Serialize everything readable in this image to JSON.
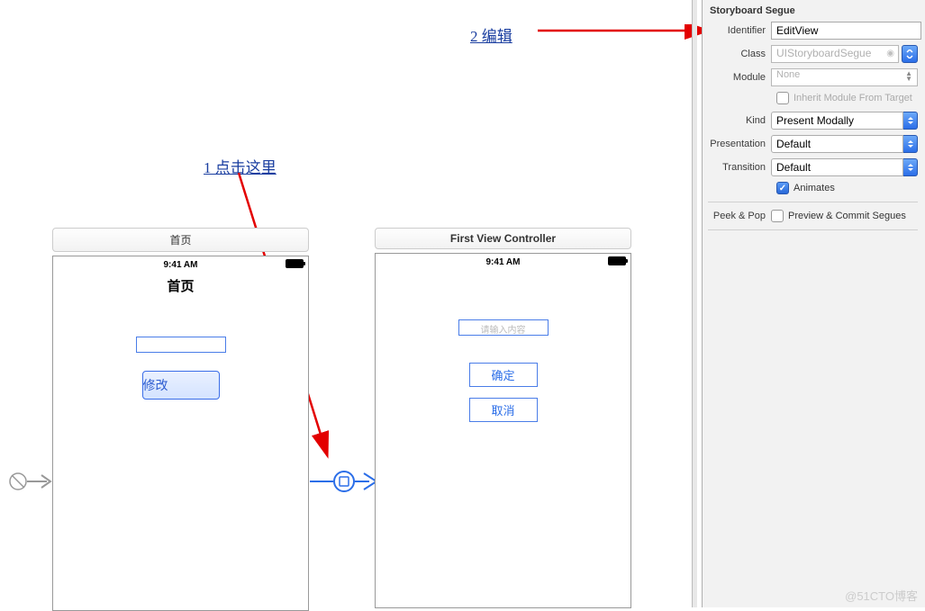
{
  "annotations": {
    "step1": "1 点击这里",
    "step2": "2  编辑"
  },
  "inspector": {
    "title": "Storyboard Segue",
    "identifier": {
      "label": "Identifier",
      "value": "EditView"
    },
    "class": {
      "label": "Class",
      "placeholder": "UIStoryboardSegue"
    },
    "module": {
      "label": "Module",
      "placeholder": "None"
    },
    "inherit": {
      "label": "Inherit Module From Target",
      "checked": false
    },
    "kind": {
      "label": "Kind",
      "value": "Present Modally"
    },
    "presentation": {
      "label": "Presentation",
      "value": "Default"
    },
    "transition": {
      "label": "Transition",
      "value": "Default"
    },
    "animates": {
      "label": "Animates",
      "checked": true
    },
    "peekpop": {
      "label": "Peek & Pop",
      "preview": "Preview & Commit Segues",
      "checked": false
    }
  },
  "scenes": {
    "home": {
      "title": "首页",
      "time": "9:41 AM",
      "nav_title": "首页",
      "modify_btn": "修改"
    },
    "first": {
      "title": "First View Controller",
      "time": "9:41 AM",
      "placeholder": "请输入内容",
      "confirm_btn": "确定",
      "cancel_btn": "取消"
    }
  },
  "watermark": "@51CTO博客"
}
